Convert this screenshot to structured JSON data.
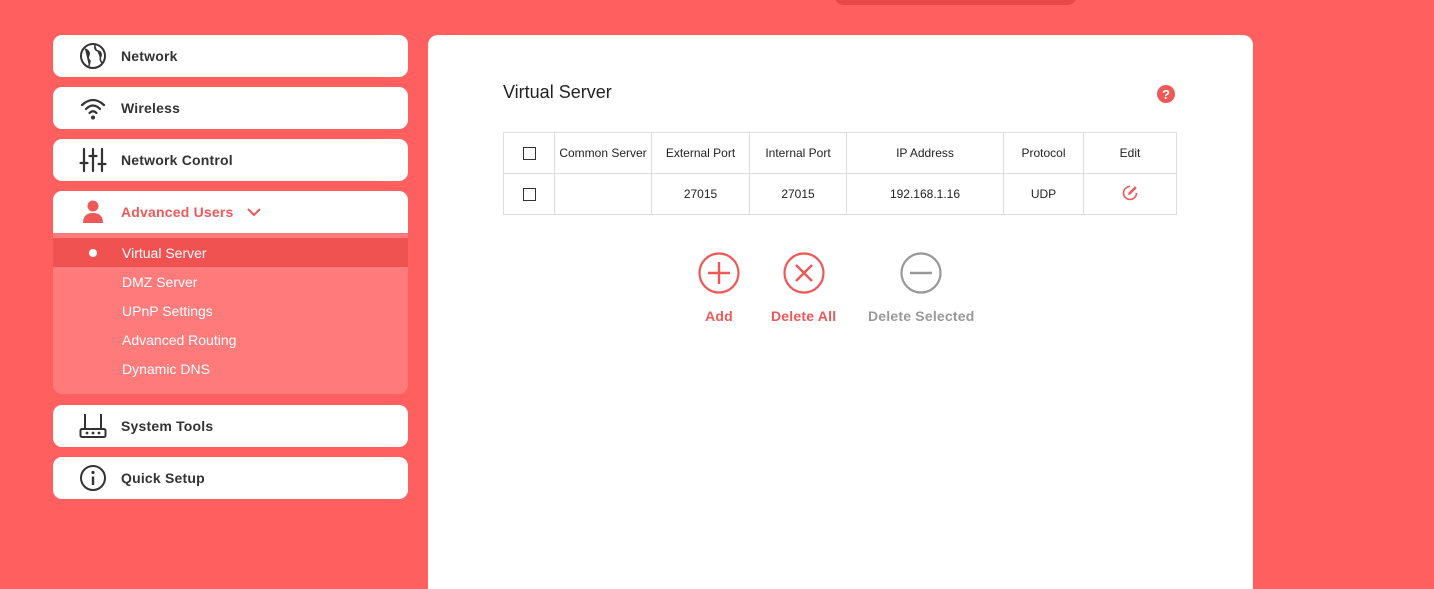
{
  "sidebar": {
    "items": [
      {
        "label": "Network",
        "icon": "globe-icon"
      },
      {
        "label": "Wireless",
        "icon": "wifi-icon"
      },
      {
        "label": "Network Control",
        "icon": "sliders-icon"
      },
      {
        "label": "Advanced Users",
        "icon": "user-icon"
      },
      {
        "label": "System Tools",
        "icon": "router-icon"
      },
      {
        "label": "Quick Setup",
        "icon": "info-icon"
      }
    ],
    "submenu": [
      {
        "label": "Virtual Server"
      },
      {
        "label": "DMZ Server"
      },
      {
        "label": "UPnP Settings"
      },
      {
        "label": "Advanced Routing"
      },
      {
        "label": "Dynamic DNS"
      }
    ]
  },
  "main": {
    "title": "Virtual Server",
    "help": "?",
    "table": {
      "headers": [
        "Common Server",
        "External Port",
        "Internal Port",
        "IP Address",
        "Protocol",
        "Edit"
      ],
      "rows": [
        {
          "common_server": "",
          "external_port": "27015",
          "internal_port": "27015",
          "ip_address": "192.168.1.16",
          "protocol": "UDP"
        }
      ]
    },
    "actions": {
      "add": "Add",
      "delete_all": "Delete All",
      "delete_selected": "Delete Selected"
    }
  },
  "colors": {
    "background": "#ff5f5f",
    "accent": "#f05858",
    "disabled": "#999999"
  }
}
